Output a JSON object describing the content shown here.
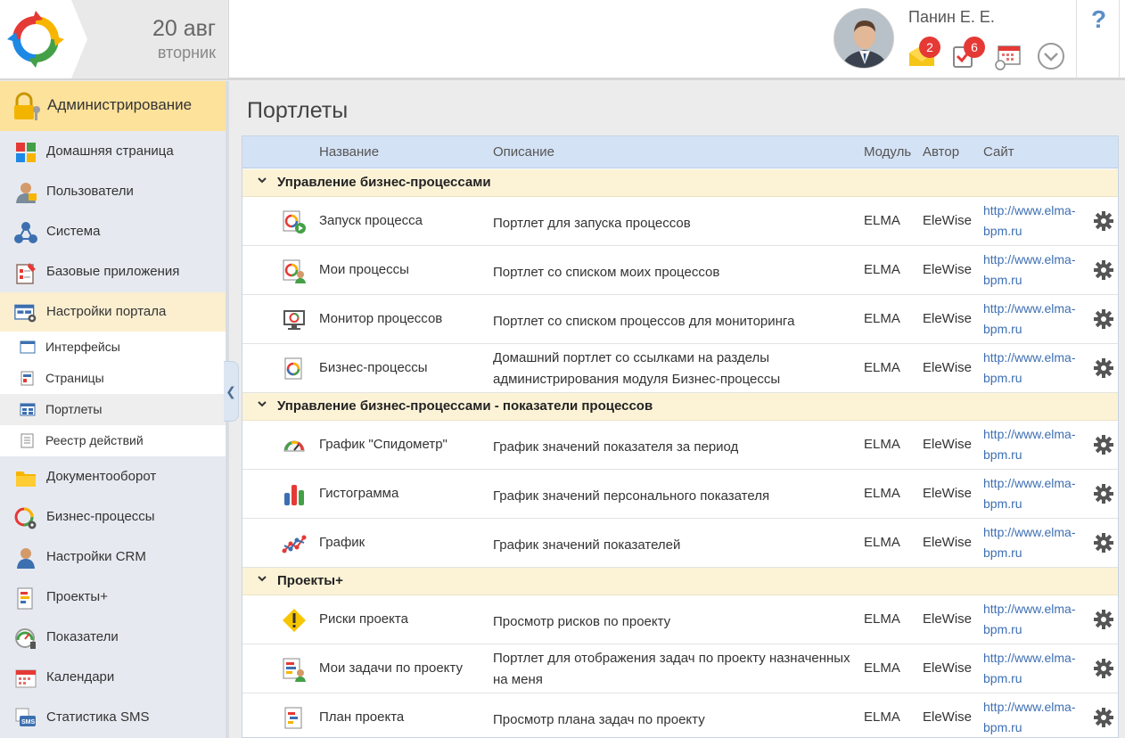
{
  "header": {
    "date_day": "20 авг",
    "date_weekday": "вторник",
    "user_name": "Панин Е. Е.",
    "messages_badge": "2",
    "tasks_badge": "6",
    "help": "?"
  },
  "sidebar": {
    "admin_label": "Администрирование",
    "items": [
      {
        "label": "Домашняя страница",
        "icon": "home-tiles-icon"
      },
      {
        "label": "Пользователи",
        "icon": "user-icon"
      },
      {
        "label": "Система",
        "icon": "network-icon"
      },
      {
        "label": "Базовые приложения",
        "icon": "clipboard-icon"
      },
      {
        "label": "Настройки портала",
        "icon": "portal-settings-icon"
      }
    ],
    "subitems": [
      {
        "label": "Интерфейсы"
      },
      {
        "label": "Страницы"
      },
      {
        "label": "Портлеты"
      },
      {
        "label": "Реестр действий"
      }
    ],
    "items2": [
      {
        "label": "Документооборот",
        "icon": "folder-icon"
      },
      {
        "label": "Бизнес-процессы",
        "icon": "process-icon"
      },
      {
        "label": "Настройки CRM",
        "icon": "crm-icon"
      },
      {
        "label": "Проекты+",
        "icon": "projects-icon"
      },
      {
        "label": "Показатели",
        "icon": "gauge-icon"
      },
      {
        "label": "Календари",
        "icon": "calendar-icon"
      },
      {
        "label": "Статистика SMS",
        "icon": "sms-icon"
      }
    ]
  },
  "main": {
    "title": "Портлеты",
    "columns": {
      "name": "Название",
      "description": "Описание",
      "module": "Модуль",
      "author": "Автор",
      "site": "Сайт"
    },
    "groups": [
      {
        "label": "Управление бизнес-процессами"
      },
      {
        "label": "Управление бизнес-процессами - показатели процессов"
      },
      {
        "label": "Проекты+"
      }
    ],
    "rows": [
      {
        "name": "Запуск процесса",
        "description": "Портлет для запуска процессов",
        "module": "ELMA",
        "author": "EleWise",
        "site1": "http://www.elma-",
        "site2": "bpm.ru",
        "icon": "process-start-icon"
      },
      {
        "name": "Мои процессы",
        "description": "Портлет со списком моих процессов",
        "module": "ELMA",
        "author": "EleWise",
        "site1": "http://www.elma-",
        "site2": "bpm.ru",
        "icon": "my-processes-icon"
      },
      {
        "name": "Монитор процессов",
        "description": "Портлет со списком процессов для мониторинга",
        "module": "ELMA",
        "author": "EleWise",
        "site1": "http://www.elma-",
        "site2": "bpm.ru",
        "icon": "monitor-icon"
      },
      {
        "name": "Бизнес-процессы",
        "description": "Домашний портлет со ссылками на разделы администрирования модуля Бизнес-процессы",
        "module": "ELMA",
        "author": "EleWise",
        "site1": "http://www.elma-",
        "site2": "bpm.ru",
        "icon": "business-process-icon"
      },
      {
        "name": "График \"Спидометр\"",
        "description": "График значений показателя за период",
        "module": "ELMA",
        "author": "EleWise",
        "site1": "http://www.elma-",
        "site2": "bpm.ru",
        "icon": "speedometer-icon"
      },
      {
        "name": "Гистограмма",
        "description": "График значений персонального показателя",
        "module": "ELMA",
        "author": "EleWise",
        "site1": "http://www.elma-",
        "site2": "bpm.ru",
        "icon": "histogram-icon"
      },
      {
        "name": "График",
        "description": "График значений показателей",
        "module": "ELMA",
        "author": "EleWise",
        "site1": "http://www.elma-",
        "site2": "bpm.ru",
        "icon": "line-graph-icon"
      },
      {
        "name": "Риски проекта",
        "description": "Просмотр рисков по проекту",
        "module": "ELMA",
        "author": "EleWise",
        "site1": "http://www.elma-",
        "site2": "bpm.ru",
        "icon": "warning-icon"
      },
      {
        "name": "Мои задачи по проекту",
        "description": "Портлет для отображения задач по проекту назначенных на меня",
        "module": "ELMA",
        "author": "EleWise",
        "site1": "http://www.elma-",
        "site2": "bpm.ru",
        "icon": "project-tasks-icon"
      },
      {
        "name": "План проекта",
        "description": "Просмотр плана задач по проекту",
        "module": "ELMA",
        "author": "EleWise",
        "site1": "http://www.elma-",
        "site2": "bpm.ru",
        "icon": "project-plan-icon"
      }
    ]
  }
}
